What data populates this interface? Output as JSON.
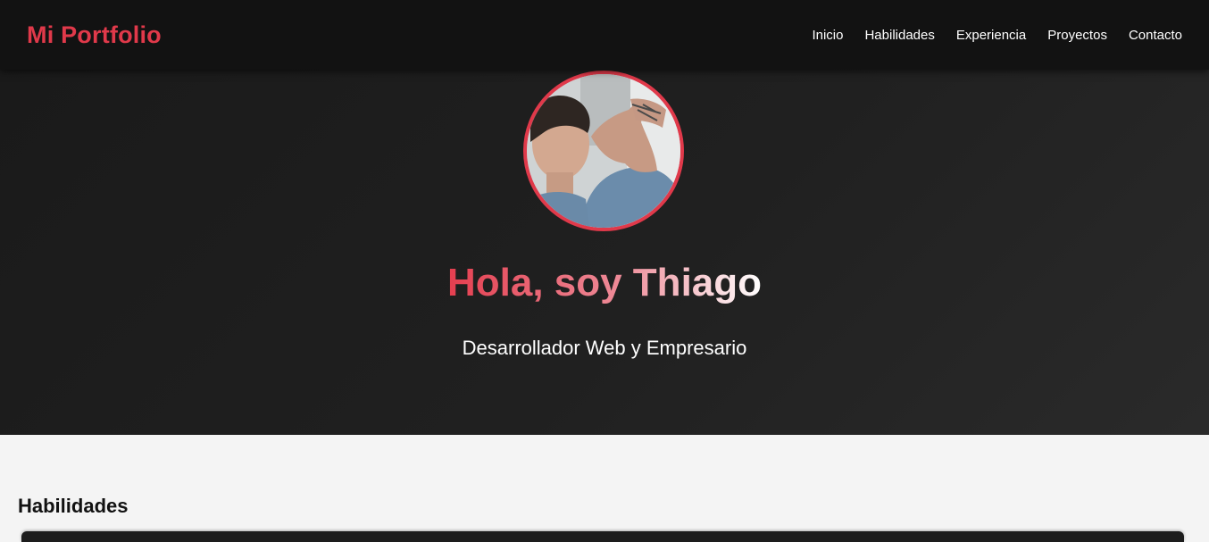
{
  "nav": {
    "brand": "Mi Portfolio",
    "links": [
      "Inicio",
      "Habilidades",
      "Experiencia",
      "Proyectos",
      "Contacto"
    ]
  },
  "hero": {
    "avatar_icon": "profile-photo",
    "title": "Hola, soy Thiago",
    "subtitle": "Desarrollador Web y Empresario"
  },
  "skills": {
    "title": "Habilidades"
  },
  "colors": {
    "accent": "#e0394a",
    "nav_bg": "#121212",
    "hero_bg": "#1e1e1e",
    "section_bg": "#f4f4f4"
  }
}
